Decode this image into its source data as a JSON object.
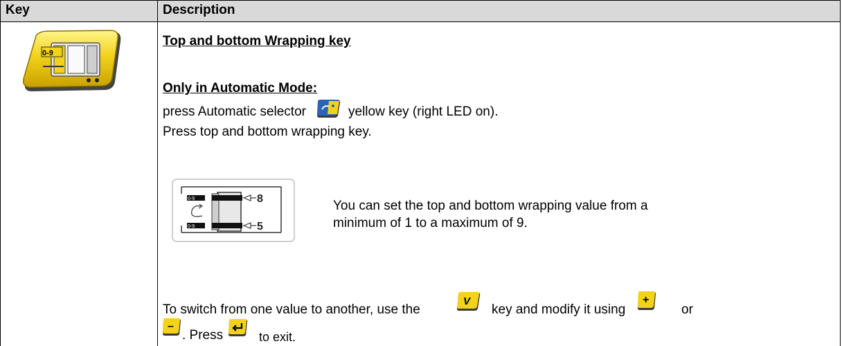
{
  "table": {
    "headers": {
      "key": "Key",
      "description": "Description"
    }
  },
  "row": {
    "key_icon_label": "0-9",
    "title": "Top and bottom Wrapping key",
    "mode_heading": "Only in Automatic Mode:",
    "line1_before": "press Automatic selector",
    "line1_after": "yellow key (right LED on).",
    "line2": "Press top and bottom wrapping key.",
    "diagram": {
      "label_top": "0-9",
      "label_bottom": "0-9",
      "value_top": "8",
      "value_bottom": "5"
    },
    "diagram_text_line1": "You can set the top and bottom wrapping value from a",
    "diagram_text_line2": "minimum of 1 to a maximum of 9.",
    "switch_before": "To switch from one value to another, use the",
    "switch_middle": "key and modify it using",
    "switch_or": "or",
    "press_text": ". Press",
    "exit_text": "to exit.",
    "keys": {
      "v_key": "V",
      "plus_key": "+",
      "minus_key": "–"
    }
  },
  "colors": {
    "key_yellow": "#f2d21b",
    "header_gray": "#d9d9d9",
    "selector_blue": "#2b63b5"
  }
}
